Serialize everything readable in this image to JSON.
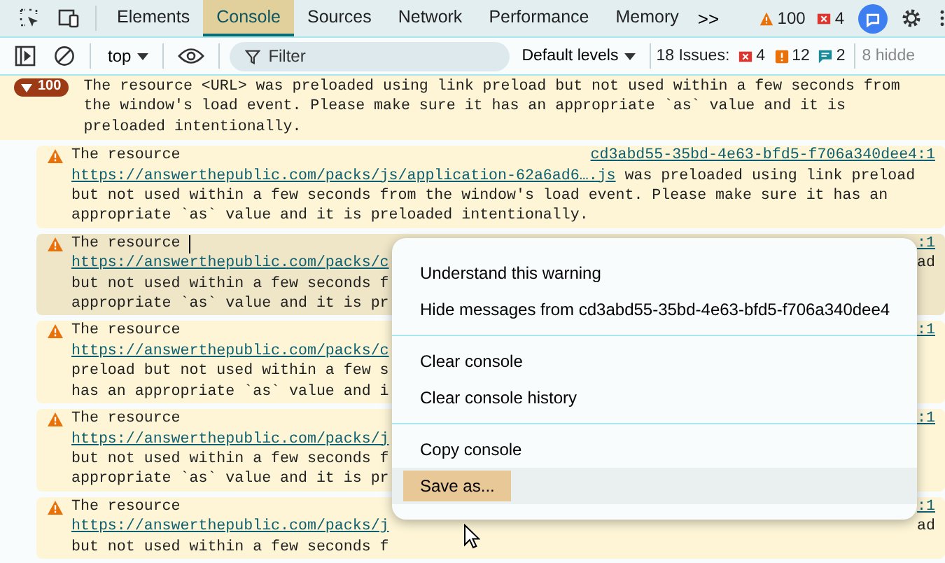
{
  "tabs": [
    {
      "label": "Elements",
      "selected": false
    },
    {
      "label": "Console",
      "selected": true
    },
    {
      "label": "Sources",
      "selected": false
    },
    {
      "label": "Network",
      "selected": false
    },
    {
      "label": "Performance",
      "selected": false
    },
    {
      "label": "Memory",
      "selected": false
    }
  ],
  "more_tabs": ">>",
  "top_counts": {
    "warnings": "100",
    "errors": "4"
  },
  "toolbar": {
    "context": "top",
    "filter_placeholder": "Filter",
    "levels": "Default levels",
    "issues_label": "18 Issues:",
    "issue_errors": "4",
    "issue_warnings": "12",
    "issue_info": "2",
    "hidden": "8 hidde"
  },
  "group": {
    "count": "100",
    "expanded": true,
    "text": "The resource <URL> was preloaded using link preload but not used within a few seconds from the window's load event. Please make sure it has an appropriate `as` value and it is preloaded intentionally."
  },
  "messages": [
    {
      "selected": false,
      "source": "cd3abd55-35bd-4e63-bfd5-f706a340dee4:1",
      "caret": false,
      "lines": [
        {
          "segments": [
            {
              "text": "The resource",
              "link": false
            }
          ]
        },
        {
          "segments": [
            {
              "text": "https://answerthepublic.com/packs/js/application-62a6ad6….js",
              "link": true
            },
            {
              "text": " was preloaded using link preload",
              "link": false
            }
          ]
        },
        {
          "segments": [
            {
              "text": "but not used within a few seconds from the window's load event. Please make sure it has an",
              "link": false
            }
          ]
        },
        {
          "segments": [
            {
              "text": "appropriate `as` value and it is preloaded intentionally.",
              "link": false
            }
          ]
        }
      ]
    },
    {
      "selected": true,
      "source": ":1",
      "caret": true,
      "lines": [
        {
          "segments": [
            {
              "text": "The resource",
              "link": false
            }
          ]
        },
        {
          "segments": [
            {
              "text": "https://answerthepublic.com/packs/c",
              "link": true
            }
          ],
          "right": "ad"
        },
        {
          "segments": [
            {
              "text": "but not used within a few seconds f",
              "link": false
            }
          ]
        },
        {
          "segments": [
            {
              "text": "appropriate `as` value and it is pr",
              "link": false
            }
          ]
        }
      ]
    },
    {
      "selected": false,
      "source": ":1",
      "caret": false,
      "lines": [
        {
          "segments": [
            {
              "text": "The resource",
              "link": false
            }
          ]
        },
        {
          "segments": [
            {
              "text": "https://answerthepublic.com/packs/c",
              "link": true
            }
          ]
        },
        {
          "segments": [
            {
              "text": "preload but not used within a few s",
              "link": false
            }
          ]
        },
        {
          "segments": [
            {
              "text": "has an appropriate `as` value and i",
              "link": false
            }
          ]
        }
      ]
    },
    {
      "selected": false,
      "source": ":1",
      "caret": false,
      "lines": [
        {
          "segments": [
            {
              "text": "The resource",
              "link": false
            }
          ]
        },
        {
          "segments": [
            {
              "text": "https://answerthepublic.com/packs/j",
              "link": true
            }
          ]
        },
        {
          "segments": [
            {
              "text": "but not used within a few seconds f",
              "link": false
            }
          ]
        },
        {
          "segments": [
            {
              "text": "appropriate `as` value and it is pr",
              "link": false
            }
          ]
        }
      ]
    },
    {
      "selected": false,
      "source": ":1",
      "caret": false,
      "lines": [
        {
          "segments": [
            {
              "text": "The resource",
              "link": false
            }
          ]
        },
        {
          "segments": [
            {
              "text": "https://answerthepublic.com/packs/j",
              "link": true
            }
          ],
          "right": "ad"
        },
        {
          "segments": [
            {
              "text": "but not used within a few seconds f",
              "link": false
            }
          ]
        }
      ]
    }
  ],
  "context_menu": {
    "groups": [
      [
        {
          "label": "Understand this warning",
          "selected": false
        },
        {
          "label": "Hide messages from cd3abd55-35bd-4e63-bfd5-f706a340dee4",
          "selected": false
        }
      ],
      [
        {
          "label": "Clear console",
          "selected": false
        },
        {
          "label": "Clear console history",
          "selected": false
        }
      ],
      [
        {
          "label": "Copy console",
          "selected": false
        },
        {
          "label": "Save as...",
          "selected": true
        }
      ]
    ]
  }
}
